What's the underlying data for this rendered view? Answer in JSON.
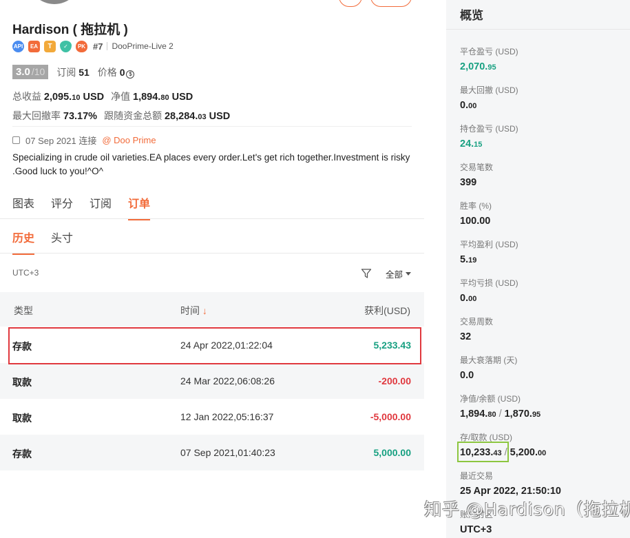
{
  "profile": {
    "name": "Hardison ( 拖拉机 )",
    "rank": "#7",
    "server": "DooPrime-Live 2",
    "badges": [
      "API",
      "EA",
      "T",
      "shield",
      "PK"
    ],
    "score": "3.0",
    "score_max": "/10",
    "subscribe_label": "订阅",
    "subscribe_count": "51",
    "price_label": "价格",
    "price_value": "0",
    "total_profit_label": "总收益",
    "total_profit_main": "2,095.",
    "total_profit_dec": "10",
    "total_profit_unit": "USD",
    "equity_label": "净值",
    "equity_main": "1,894.",
    "equity_dec": "80",
    "equity_unit": "USD",
    "max_dd_label": "最大回撤率",
    "max_dd_value": "73.17%",
    "follow_label": "跟随资金总额",
    "follow_main": "28,284.",
    "follow_dec": "03",
    "follow_unit": "USD",
    "connect_date": "07 Sep 2021 连接",
    "broker": "@ Doo Prime",
    "description": "Specializing in crude oil varieties.EA places every order.Let's get rich together.Investment is risky .Good luck to you!^O^"
  },
  "tabs": [
    "图表",
    "评分",
    "订阅",
    "订单"
  ],
  "active_tab": 3,
  "subtabs": [
    "历史",
    "头寸"
  ],
  "active_subtab": 0,
  "timezone": "UTC+3",
  "filter_label": "全部",
  "table": {
    "headers": [
      "类型",
      "时间",
      "获利(USD)"
    ],
    "sort_arrow": "↓",
    "rows": [
      {
        "type": "存款",
        "time": "24 Apr 2022,01:22:04",
        "profit": "5,233.43",
        "sign": "pos"
      },
      {
        "type": "取款",
        "time": "24 Mar 2022,06:08:26",
        "profit": "-200.00",
        "sign": "neg"
      },
      {
        "type": "取款",
        "time": "12 Jan 2022,05:16:37",
        "profit": "-5,000.00",
        "sign": "neg"
      },
      {
        "type": "存款",
        "time": "07 Sep 2021,01:40:23",
        "profit": "5,000.00",
        "sign": "pos"
      }
    ]
  },
  "overview": {
    "title": "概览",
    "stats": [
      {
        "label": "平仓盈亏 (USD)",
        "main": "2,070.",
        "dec": "95",
        "green": true
      },
      {
        "label": "最大回撤 (USD)",
        "main": "0.",
        "dec": "00",
        "green": false
      },
      {
        "label": "持仓盈亏 (USD)",
        "main": "24.",
        "dec": "15",
        "green": true
      },
      {
        "label": "交易笔数",
        "main": "399",
        "dec": "",
        "green": false
      },
      {
        "label": "胜率 (%)",
        "main": "100.00",
        "dec": "",
        "green": false
      },
      {
        "label": "平均盈利 (USD)",
        "main": "5.",
        "dec": "19",
        "green": false
      },
      {
        "label": "平均亏损 (USD)",
        "main": "0.",
        "dec": "00",
        "green": false
      },
      {
        "label": "交易周数",
        "main": "32",
        "dec": "",
        "green": false
      },
      {
        "label": "最大衰落期 (天)",
        "main": "0.0",
        "dec": "",
        "green": false
      }
    ],
    "equity_balance_label": "净值/余额 (USD)",
    "equity_main": "1,894.",
    "equity_dec": "80",
    "balance_main": "1,870.",
    "balance_dec": "95",
    "deposit_label": "存/取款 (USD)",
    "deposit_main": "10,233.",
    "deposit_dec": "43",
    "withdraw_main": "5,200.",
    "withdraw_dec": "00",
    "last_trade_label": "最近交易",
    "last_trade_value": "25 Apr 2022, 21:50:10",
    "account_tz_label": "账户时区",
    "account_tz_value": "UTC+3"
  },
  "watermark": "知乎 @Hardison（拖拉机）"
}
